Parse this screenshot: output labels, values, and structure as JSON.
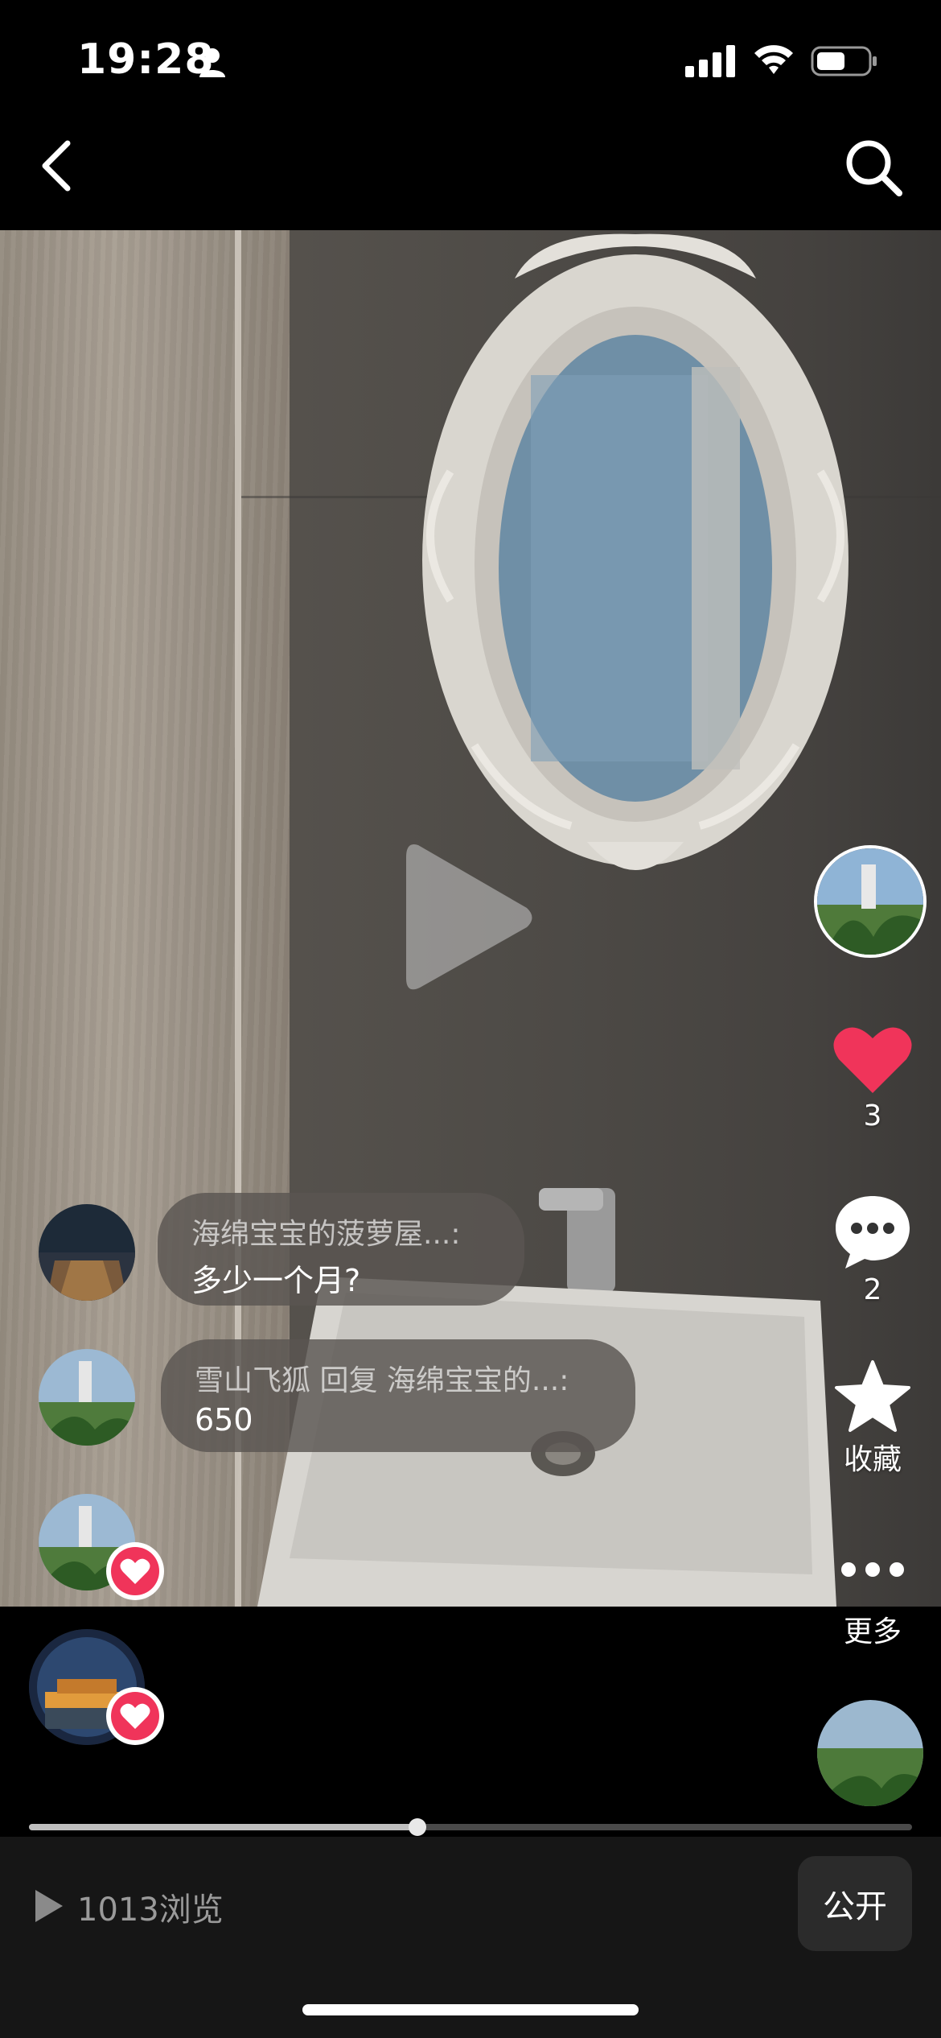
{
  "status_bar": {
    "time": "19:28"
  },
  "post": {
    "likes": "3",
    "comments": "2",
    "favorite_label": "收藏",
    "more_label": "更多"
  },
  "comment_bubbles": [
    {
      "author": "海绵宝宝的菠萝屋...:",
      "text": "多少一个月?"
    },
    {
      "author": "雪山飞狐 回复 海绵宝宝的...:",
      "text": "650"
    }
  ],
  "footer": {
    "views": "1013浏览",
    "visibility_label": "公开",
    "progress": 0.44
  },
  "colors": {
    "like_red": "#f0345a",
    "background": "#000000"
  },
  "icons": [
    "person-icon",
    "signal-icon",
    "wifi-icon",
    "battery-icon",
    "back-icon",
    "search-icon",
    "play-icon",
    "heart-icon",
    "comment-icon",
    "star-icon",
    "more-icon"
  ]
}
